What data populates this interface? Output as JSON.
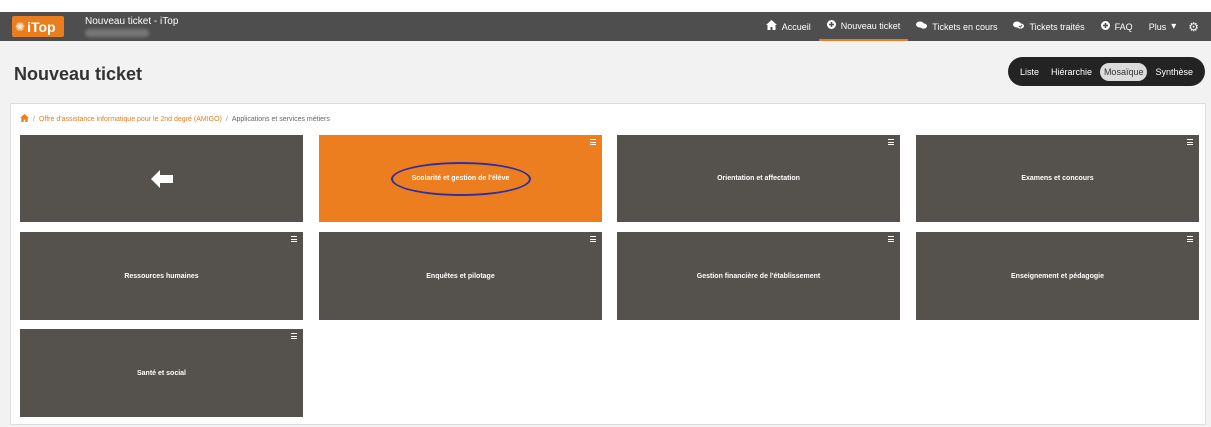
{
  "header": {
    "logo_text": "iTop",
    "app_title": "Nouveau ticket - iTop",
    "nav": [
      {
        "label": "Accueil",
        "icon": "home-icon",
        "active": false
      },
      {
        "label": "Nouveau ticket",
        "icon": "plus-circle-icon",
        "active": true
      },
      {
        "label": "Tickets en cours",
        "icon": "comments-icon",
        "active": false
      },
      {
        "label": "Tickets traités",
        "icon": "comments-check-icon",
        "active": false
      },
      {
        "label": "FAQ",
        "icon": "question-circle-icon",
        "active": false
      },
      {
        "label": "Plus",
        "icon": "caret-down-icon",
        "active": false
      }
    ],
    "settings_icon": "gears-icon"
  },
  "page": {
    "title": "Nouveau ticket",
    "view_options": [
      {
        "label": "Liste",
        "selected": false
      },
      {
        "label": "Hiérarchie",
        "selected": false
      },
      {
        "label": "Mosaïque",
        "selected": true
      },
      {
        "label": "Synthèse",
        "selected": false
      }
    ]
  },
  "breadcrumb": {
    "home_icon": "home-icon",
    "items": [
      {
        "label": "Offre d'assistance informatique pour le 2nd degré (AMIGO)",
        "link": true
      },
      {
        "label": "Applications et services métiers",
        "link": false
      }
    ],
    "separator": "/"
  },
  "tiles": [
    {
      "label": "",
      "type": "back",
      "icon": "arrow-left-icon"
    },
    {
      "label": "Scolarité et gestion de l'élève",
      "type": "category",
      "active": true,
      "highlighted": true
    },
    {
      "label": "Orientation et affectation",
      "type": "category"
    },
    {
      "label": "Examens et concours",
      "type": "category"
    },
    {
      "label": "Ressources humaines",
      "type": "category"
    },
    {
      "label": "Enquêtes et pilotage",
      "type": "category"
    },
    {
      "label": "Gestion financière de l'établissement",
      "type": "category"
    },
    {
      "label": "Enseignement et pédagogie",
      "type": "category"
    },
    {
      "label": "Santé et social",
      "type": "category"
    }
  ],
  "colors": {
    "navbar": "#4e4e4e",
    "accent": "#ea7d1e",
    "tile": "#55524d",
    "tile_active": "#ec7e1f",
    "highlight_ring": "#2d2fa6",
    "view_switch": "#232323"
  }
}
